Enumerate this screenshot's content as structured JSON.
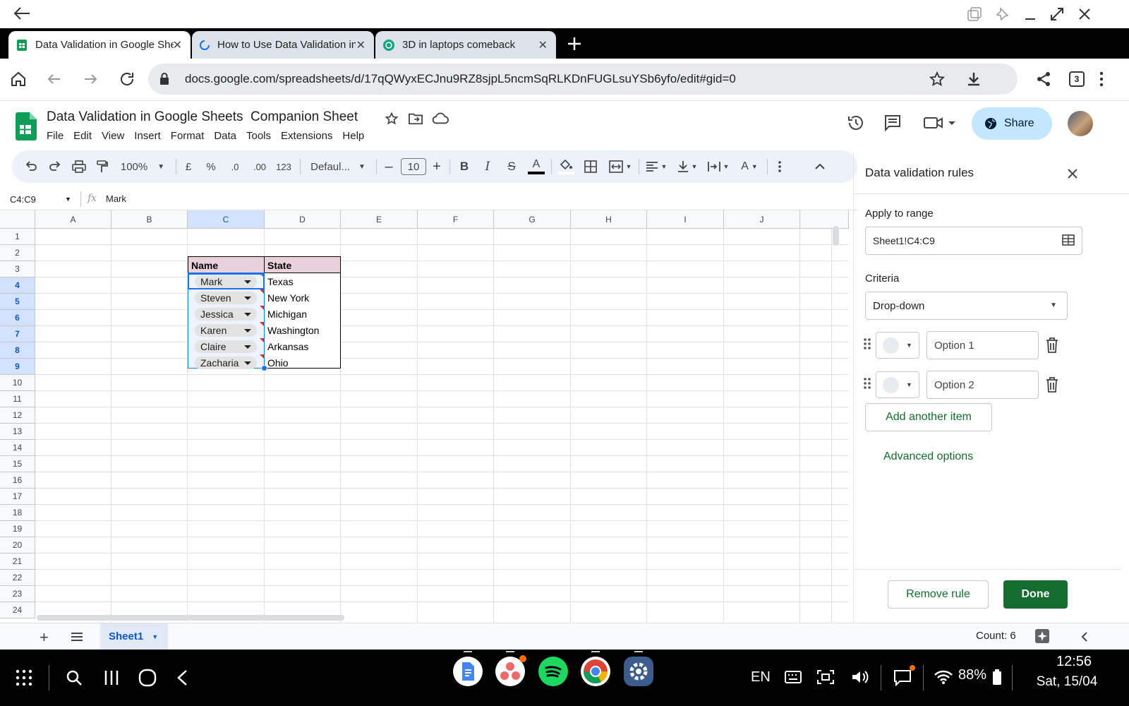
{
  "window": {
    "back_icon": "arrow-left-icon"
  },
  "tabs": [
    {
      "title": "Data Validation in Google She",
      "active": true
    },
    {
      "title": "How to Use Data Validation in",
      "active": false
    },
    {
      "title": "3D in laptops comeback",
      "active": false
    }
  ],
  "browser": {
    "url": "docs.google.com/spreadsheets/d/17qQWyxECJnu9RZ8sjpL5ncmSqRLKDnFUGLsuYSb6yfo/edit#gid=0",
    "tab_count": "3"
  },
  "doc": {
    "title": "Data Validation in Google Sheets  Companion Sheet",
    "menus": [
      "File",
      "Edit",
      "View",
      "Insert",
      "Format",
      "Data",
      "Tools",
      "Extensions",
      "Help"
    ],
    "share_label": "Share"
  },
  "toolbar": {
    "zoom": "100%",
    "currency": "£",
    "percent": "%",
    "dec_decrease": ".0",
    "dec_increase": ".00",
    "format_more": "123",
    "font": "Defaul...",
    "font_size": "10"
  },
  "formula_bar": {
    "name_box": "C4:C9",
    "fx": "fx",
    "content": "Mark"
  },
  "grid": {
    "columns": [
      "A",
      "B",
      "C",
      "D",
      "E",
      "F",
      "G",
      "H",
      "I",
      "J"
    ],
    "rows": [
      "1",
      "2",
      "3",
      "4",
      "5",
      "6",
      "7",
      "8",
      "9",
      "10",
      "11",
      "12",
      "13",
      "14",
      "15",
      "16",
      "17",
      "18",
      "19",
      "20",
      "21",
      "22",
      "23",
      "24"
    ],
    "header": {
      "name": "Name",
      "state": "State"
    },
    "data": [
      {
        "name": "Mark",
        "state": "Texas"
      },
      {
        "name": "Steven",
        "state": "New York"
      },
      {
        "name": "Jessica",
        "state": "Michigan"
      },
      {
        "name": "Karen",
        "state": "Washington"
      },
      {
        "name": "Claire",
        "state": "Arkansas"
      },
      {
        "name": "Zacharia",
        "state": "Ohio"
      }
    ]
  },
  "sheets": {
    "active": "Sheet1",
    "count_label": "Count: 6"
  },
  "panel": {
    "title": "Data validation rules",
    "apply_label": "Apply to range",
    "range": "Sheet1!C4:C9",
    "criteria_label": "Criteria",
    "criteria_value": "Drop-down",
    "options": [
      {
        "placeholder": "Option 1"
      },
      {
        "placeholder": "Option 2"
      }
    ],
    "add_item": "Add another item",
    "advanced": "Advanced options",
    "remove": "Remove rule",
    "done": "Done",
    "accent": "#146c2e"
  },
  "taskbar": {
    "lang": "EN",
    "battery": "88%",
    "time": "12:56",
    "date": "Sat, 15/04"
  }
}
